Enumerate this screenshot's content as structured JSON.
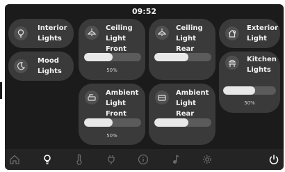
{
  "status_bar": {
    "time": "09:52"
  },
  "tiles": {
    "interior": {
      "line1": "Interior",
      "line2": "Lights",
      "icon": "bulb-icon"
    },
    "mood": {
      "line1": "Mood",
      "line2": "Lights",
      "icon": "moon-icon"
    },
    "ceiling_front": {
      "line1": "Ceiling",
      "line2": "Light Front",
      "icon": "ceiling-lamp-icon",
      "level": 0.5,
      "percent_label": "50%"
    },
    "ceiling_rear": {
      "line1": "Ceiling",
      "line2": "Light Rear",
      "icon": "ceiling-lamp-icon",
      "level": 0.6
    },
    "ambient_front": {
      "line1": "Ambient",
      "line2": "Light Front",
      "icon": "ambient-front-icon",
      "level": 0.5,
      "percent_label": "50%"
    },
    "ambient_rear": {
      "line1": "Ambient",
      "line2": "Light Rear",
      "icon": "ambient-rear-icon",
      "level": 0.6
    },
    "exterior": {
      "line1": "Exterior",
      "line2": "Light",
      "icon": "house-icon"
    },
    "kitchen": {
      "line1": "Kitchen",
      "line2": "Lights",
      "icon": "kitchen-lamp-icon",
      "level": 0.6,
      "percent_label": "50%"
    }
  },
  "nav": {
    "items": [
      "home-icon",
      "bulb-icon",
      "thermometer-icon",
      "power-plug-icon",
      "info-icon",
      "music-note-icon",
      "settings-gear-icon",
      "power-icon"
    ],
    "active": "bulb-icon"
  },
  "colors": {
    "background": "#1b1b1b",
    "tile": "#3a3a3a",
    "slider_track": "#5b5b5b",
    "slider_fill": "#e8e8e8",
    "active_icon": "#ffffff",
    "inactive_icon": "#6a6a6a"
  }
}
